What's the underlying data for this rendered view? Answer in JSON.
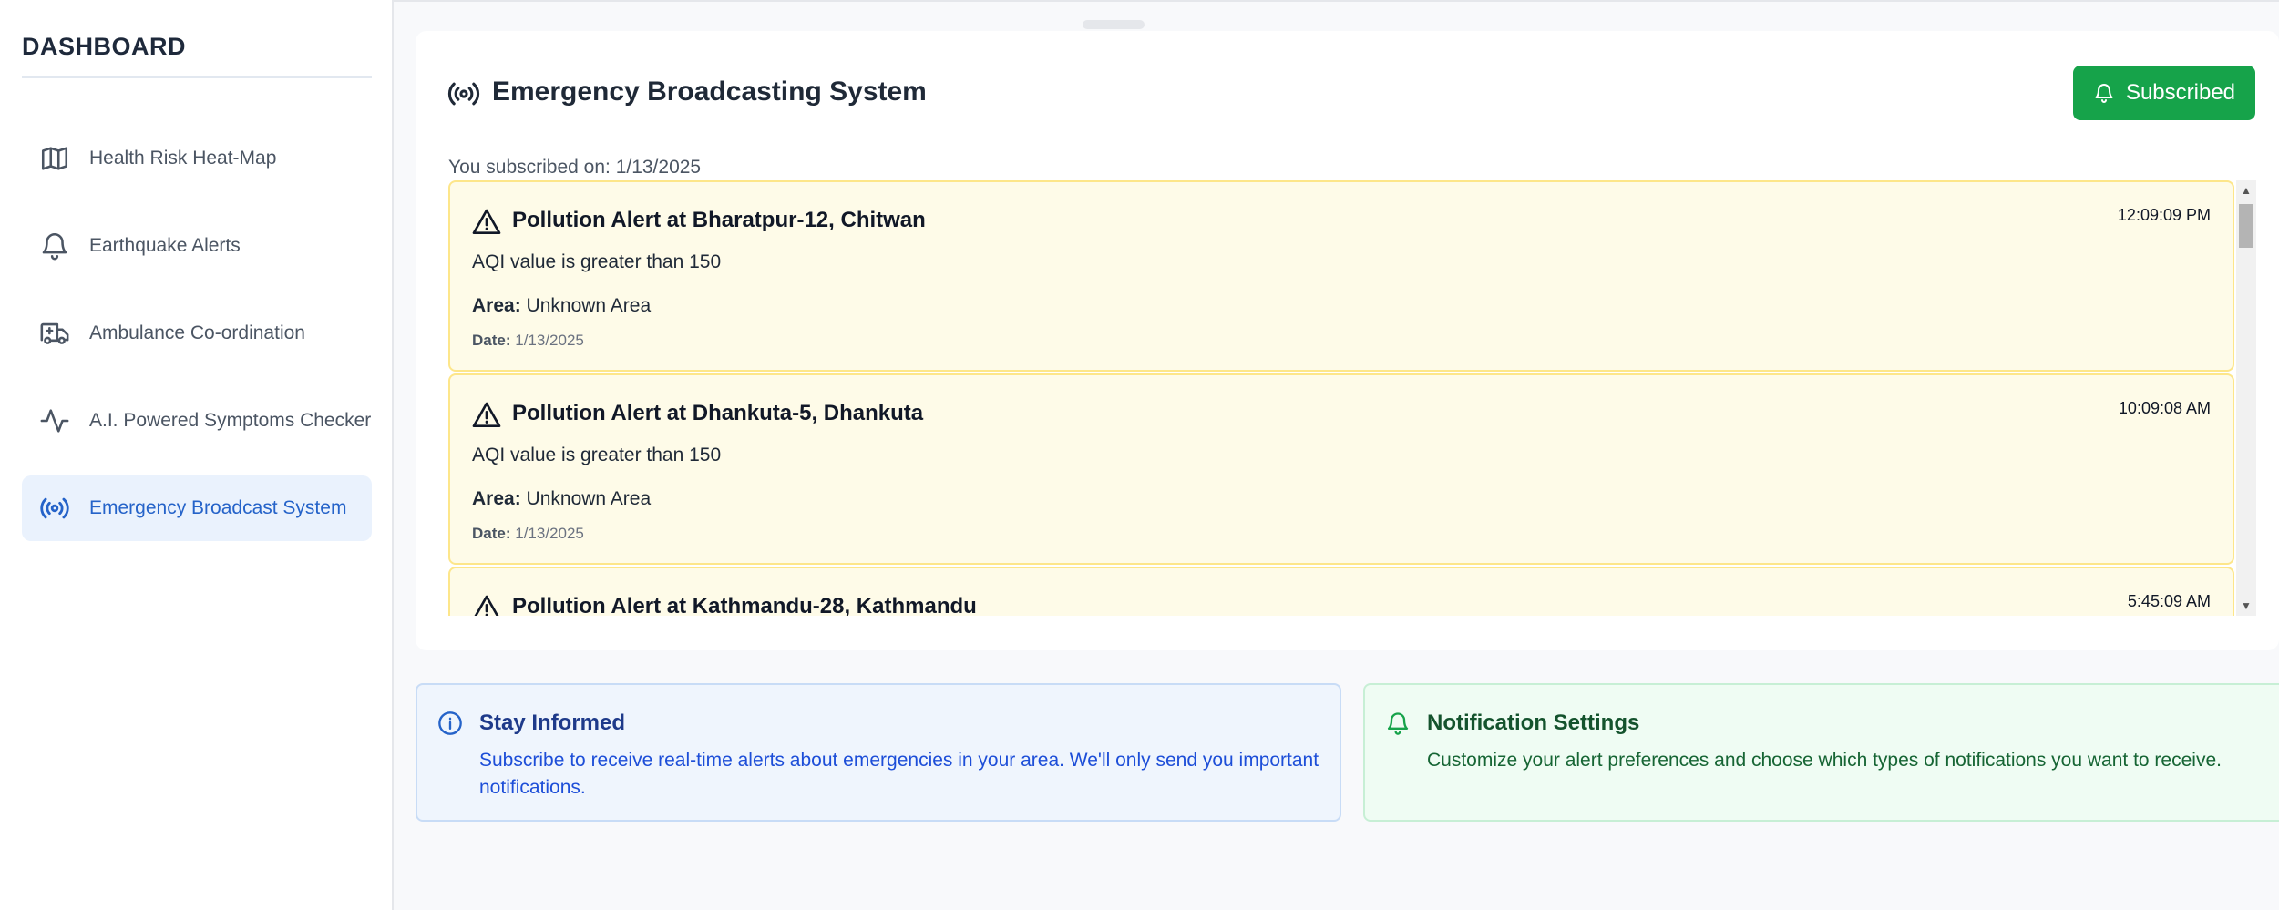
{
  "sidebar": {
    "title": "DASHBOARD",
    "items": [
      {
        "label": "Health Risk Heat-Map",
        "icon": "map-icon"
      },
      {
        "label": "Earthquake Alerts",
        "icon": "bell-icon"
      },
      {
        "label": "Ambulance Co-ordination",
        "icon": "ambulance-icon"
      },
      {
        "label": "A.I. Powered Symptoms Checker",
        "icon": "activity-icon"
      },
      {
        "label": "Emergency Broadcast System",
        "icon": "radio-icon",
        "active": true
      }
    ]
  },
  "header": {
    "title": "Emergency Broadcasting System",
    "subscribe_label": "Subscribed",
    "subscribed_on": "You subscribed on: 1/13/2025"
  },
  "alerts": [
    {
      "title": "Pollution Alert at Bharatpur-12, Chitwan",
      "time": "12:09:09 PM",
      "message": "AQI value is greater than 150",
      "area_label": "Area:",
      "area": "Unknown Area",
      "date_label": "Date:",
      "date": "1/13/2025"
    },
    {
      "title": "Pollution Alert at Dhankuta-5, Dhankuta",
      "time": "10:09:08 AM",
      "message": "AQI value is greater than 150",
      "area_label": "Area:",
      "area": "Unknown Area",
      "date_label": "Date:",
      "date": "1/13/2025"
    },
    {
      "title": "Pollution Alert at Kathmandu-28, Kathmandu",
      "time": "5:45:09 AM",
      "message": "",
      "area_label": "",
      "area": "",
      "date_label": "",
      "date": ""
    }
  ],
  "info": {
    "stay_informed": {
      "title": "Stay Informed",
      "text": "Subscribe to receive real-time alerts about emergencies in your area. We'll only send you important notifications."
    },
    "notification_settings": {
      "title": "Notification Settings",
      "text": "Customize your alert preferences and choose which types of notifications you want to receive."
    }
  },
  "colors": {
    "accent_blue": "#2563c9",
    "success_green": "#16a34a",
    "alert_bg": "#fefbe8",
    "alert_border": "#fde68a"
  }
}
